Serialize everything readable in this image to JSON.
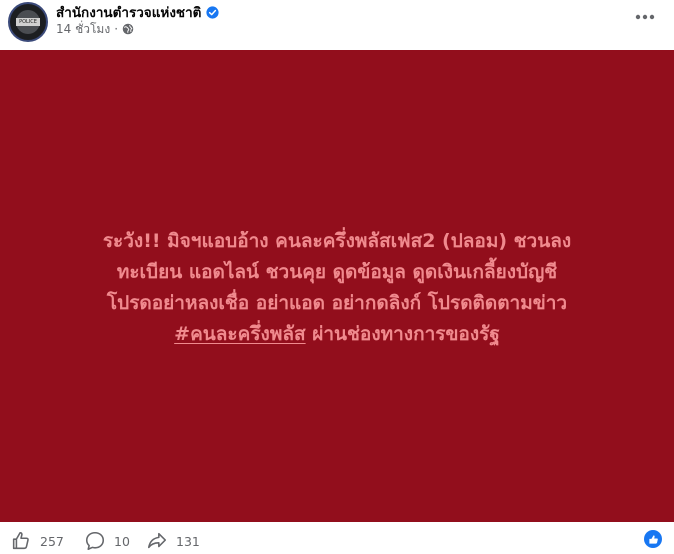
{
  "post": {
    "page_name": "สำนักงานตำรวจแห่งชาติ",
    "avatar_text": "POLICE",
    "verified_icon": "verified-badge-icon",
    "timestamp": "14 ชั่วโมง",
    "separator": "·",
    "audience_icon": "globe-icon",
    "more_icon": "more-options-icon"
  },
  "image": {
    "background_color": "#920e1c",
    "text_color": "#f08a8e",
    "lines": [
      "ระวัง!! มิจฯแอบอ้าง คนละครึ่งพลัสเฟส2 (ปลอม) ชวนลง",
      "ทะเบียน แอดไลน์ ชวนคุย ดูดข้อมูล ดูดเงินเกลี้ยงบัญชี",
      "โปรดอย่าหลงเชื่อ อย่าแอด อย่ากดลิงก์ โปรดติดตามข่าว"
    ],
    "hashtag": "#คนละครึ่งพลัส",
    "last_line_rest": " ผ่านช่องทางการของรัฐ"
  },
  "footer": {
    "likes": "257",
    "comments": "10",
    "shares": "131",
    "like_icon": "thumbs-up-icon",
    "comment_icon": "comment-icon",
    "share_icon": "share-icon",
    "reaction_icon": "like-reaction-icon"
  }
}
